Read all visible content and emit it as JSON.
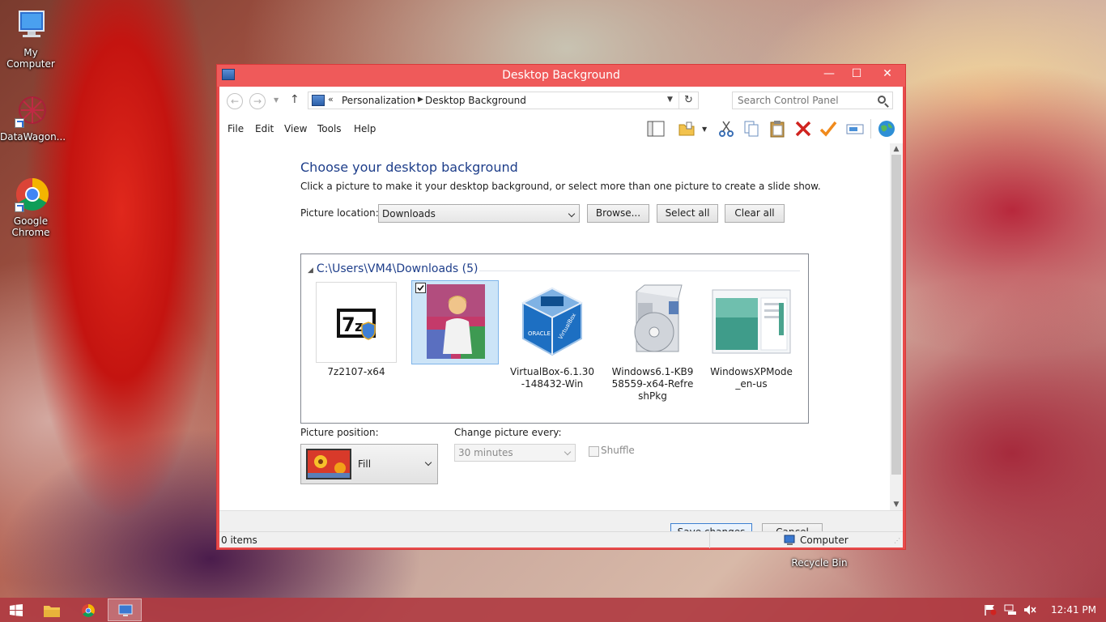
{
  "desktop": {
    "icons": [
      {
        "label_line1": "My",
        "label_line2": "Computer"
      },
      {
        "label_line1": "DataWagon...",
        "label_line2": ""
      },
      {
        "label_line1": "Google",
        "label_line2": "Chrome"
      }
    ],
    "recycle_bin_label": "Recycle Bin"
  },
  "window": {
    "title": "Desktop Background",
    "controls": {
      "minimize": "—",
      "maximize": "☐",
      "close": "✕"
    },
    "accent_color": "#e84b4b"
  },
  "address_bar": {
    "overflow": "«",
    "crumbs": [
      "Personalization",
      "Desktop Background"
    ],
    "search_placeholder": "Search Control Panel"
  },
  "menu": {
    "items": [
      "File",
      "Edit",
      "View",
      "Tools",
      "Help"
    ]
  },
  "content": {
    "heading": "Choose your desktop background",
    "subtitle": "Click a picture to make it your desktop background, or select more than one picture to create a slide show.",
    "picture_location_label": "Picture location:",
    "picture_location_value": "Downloads",
    "browse_label": "Browse...",
    "select_all_label": "Select all",
    "clear_all_label": "Clear all",
    "group_header": "C:\\Users\\VM4\\Downloads (5)",
    "tiles": [
      {
        "caption": "7z2107-x64",
        "checked": false
      },
      {
        "caption": "",
        "checked": true
      },
      {
        "caption": "VirtualBox-6.1.30-148432-Win",
        "checked": false
      },
      {
        "caption": "Windows6.1-KB958559-x64-RefreshPkg",
        "checked": false
      },
      {
        "caption": "WindowsXPMode_en-us",
        "checked": false
      }
    ],
    "picture_position_label": "Picture position:",
    "picture_position_value": "Fill",
    "change_every_label": "Change picture every:",
    "change_every_value": "30 minutes",
    "shuffle_label": "Shuffle"
  },
  "footer": {
    "save_label": "Save changes",
    "cancel_label": "Cancel"
  },
  "statusbar": {
    "items_text": "0 items",
    "location_text": "Computer"
  },
  "taskbar": {
    "clock": "12:41 PM"
  }
}
